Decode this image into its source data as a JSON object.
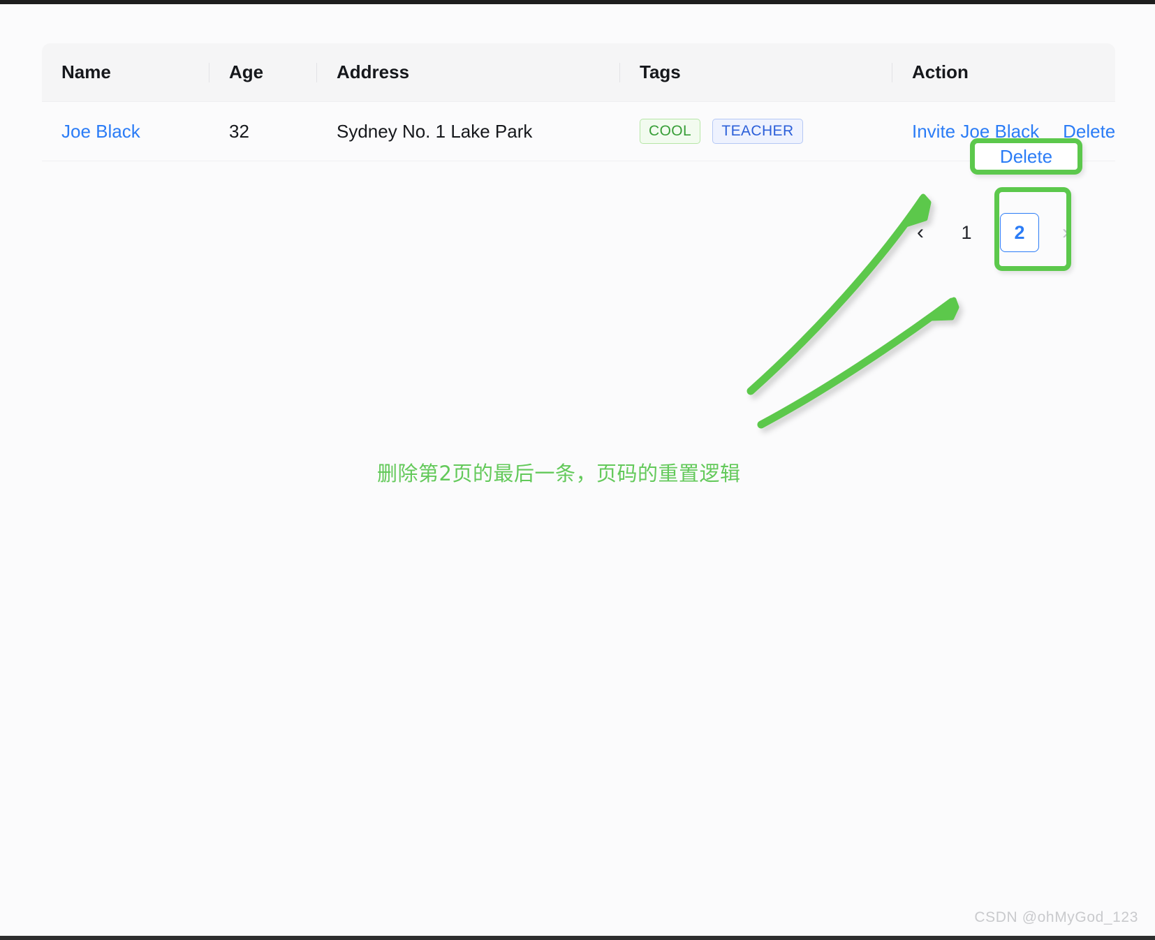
{
  "table": {
    "columns": [
      {
        "key": "name",
        "label": "Name"
      },
      {
        "key": "age",
        "label": "Age"
      },
      {
        "key": "address",
        "label": "Address"
      },
      {
        "key": "tags",
        "label": "Tags"
      },
      {
        "key": "action",
        "label": "Action"
      }
    ],
    "rows": [
      {
        "name": "Joe Black",
        "age": "32",
        "address": "Sydney No. 1 Lake Park",
        "tags": [
          "COOL",
          "TEACHER"
        ],
        "actions": [
          "Invite Joe Black",
          "Delete"
        ]
      }
    ]
  },
  "pagination": {
    "prev_icon": "chevron-left-icon",
    "prev_glyph": "‹",
    "next_icon": "chevron-right-icon",
    "next_glyph": "›",
    "pages": [
      "1",
      "2"
    ],
    "current_page": "2"
  },
  "annotation": {
    "caption": "删除第2页的最后一条，页码的重置逻辑",
    "color": "#63c95a",
    "highlight_targets": [
      "Delete",
      "2"
    ]
  },
  "watermark": {
    "text": "CSDN @ohMyGod_123"
  },
  "colors": {
    "link": "#2b7cf6",
    "tag_cool_text": "#379e37",
    "tag_cool_bg": "#f2fbef",
    "tag_cool_border": "#b6e6a6",
    "tag_teacher_text": "#2b5fd9",
    "tag_teacher_bg": "#eef2fe",
    "tag_teacher_border": "#b5c8f5",
    "header_bg": "#f5f5f6",
    "annotation_green": "#5cc84c",
    "page_bg": "#fbfbfc"
  }
}
